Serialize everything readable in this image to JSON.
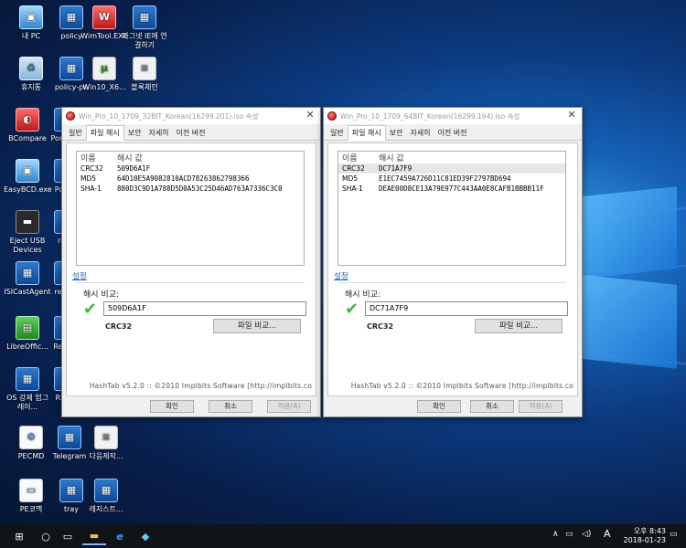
{
  "desktop": {
    "icons": [
      {
        "label": "내 PC",
        "glyph": "▣",
        "style": "g-pc"
      },
      {
        "label": "policy",
        "glyph": "▦",
        "style": "g-app"
      },
      {
        "label": "WimTool.EXE",
        "glyph": "W",
        "style": "g-red"
      },
      {
        "label": "마그넷 IE에 연결하기",
        "glyph": "▦",
        "style": "g-app"
      },
      {
        "label": "휴지통",
        "glyph": "♻",
        "style": "g-bin"
      },
      {
        "label": "policy-pe",
        "glyph": "▦",
        "style": "g-app"
      },
      {
        "label": "Win10_X6...",
        "glyph": "µ",
        "style": "g-tor"
      },
      {
        "label": "블록체인",
        "glyph": "≡",
        "style": "g-doc"
      },
      {
        "label": "BCompare",
        "glyph": "◐",
        "style": "g-red"
      },
      {
        "label": "Port 한글",
        "glyph": "▦",
        "style": "g-app"
      },
      {
        "label": "EasyBCD.exe",
        "glyph": "▣",
        "style": "g-pc"
      },
      {
        "label": "PotPla",
        "glyph": "▶",
        "style": "g-app"
      },
      {
        "label": "Eject USB Devices",
        "glyph": "▬",
        "style": "g-usb"
      },
      {
        "label": "rege",
        "glyph": "▦",
        "style": "g-app"
      },
      {
        "label": "ISICastAgent",
        "glyph": "▦",
        "style": "g-app"
      },
      {
        "label": "regedi",
        "glyph": "▦",
        "style": "g-app"
      },
      {
        "label": "LibreOffic...",
        "glyph": "▤",
        "style": "g-grn"
      },
      {
        "label": "RegWo",
        "glyph": "▦",
        "style": "g-app"
      },
      {
        "label": "OS 강제 업그레이...",
        "glyph": "▦",
        "style": "g-app"
      },
      {
        "label": "RS2업",
        "glyph": "▦",
        "style": "g-app"
      },
      {
        "label": "PECMD",
        "glyph": "⚙",
        "style": "g-tg"
      },
      {
        "label": "Telegram",
        "glyph": "▦",
        "style": "g-app"
      },
      {
        "label": "다음제작...",
        "glyph": "≡",
        "style": "g-doc"
      },
      {
        "label": "PE코맥",
        "glyph": "▭",
        "style": "g-tg"
      },
      {
        "label": "tray",
        "glyph": "▦",
        "style": "g-app"
      },
      {
        "label": "레지스트...",
        "glyph": "▦",
        "style": "g-app"
      }
    ]
  },
  "dialogs": [
    {
      "title": "Win_Pro_10_1709_32BIT_Korean(16299.201).iso 속성",
      "close": "✕",
      "tabs": [
        "일반",
        "파일 해시",
        "보안",
        "자세히",
        "이전 버전"
      ],
      "active_tab": 1,
      "list_header": {
        "name": "이름",
        "value": "해시 값"
      },
      "hashes": [
        {
          "name": "CRC32",
          "value": "509D6A1F"
        },
        {
          "name": "MD5",
          "value": "64D10E5A9082810ACD78263862798366"
        },
        {
          "name": "SHA-1",
          "value": "880D3C9D1A788D5D0A53C25D46AD763A7336C3C0"
        }
      ],
      "settings_link": "설정",
      "compare_label": "해시 비교:",
      "compare_value": "509D6A1F",
      "algorithm": "CRC32",
      "file_compare_button": "파일 비교...",
      "credit": "HashTab v5.2.0 :: ©2010 Implbits Software [http://implbits.co",
      "buttons": {
        "ok": "확인",
        "cancel": "취소",
        "apply": "적용(A)"
      }
    },
    {
      "title": "Win_Pro_10_1709_64BIT_Korean(16299.194).iso 속성",
      "close": "✕",
      "tabs": [
        "일반",
        "파일 해시",
        "보안",
        "자세히",
        "이전 버전"
      ],
      "active_tab": 1,
      "list_header": {
        "name": "이름",
        "value": "해시 값"
      },
      "hashes": [
        {
          "name": "CRC32",
          "value": "DC71A7F9"
        },
        {
          "name": "MD5",
          "value": "E1EC7459A726D11C81ED39F2797BD694"
        },
        {
          "name": "SHA-1",
          "value": "DEAE00D8CE13A79E977C443AA0E8CAFB1BBBB11F"
        }
      ],
      "settings_link": "설정",
      "compare_label": "해시 비교:",
      "compare_value": "DC71A7F9",
      "algorithm": "CRC32",
      "file_compare_button": "파일 비교...",
      "credit": "HashTab v5.2.0 :: ©2010 Implbits Software [http://implbits.co",
      "buttons": {
        "ok": "확인",
        "cancel": "취소",
        "apply": "적용(A)"
      }
    }
  ],
  "taskbar": {
    "start_icon": "⊞",
    "search_icon": "○",
    "taskview_icon": "▭",
    "explorer_icon": "▬",
    "ie_icon": "e",
    "app_icon": "◆",
    "tray_chevron": "∧",
    "network_icon": "▭",
    "volume_icon": "◁)",
    "ime": "A",
    "time": "오후 8:43",
    "date": "2018-01-23",
    "notification_icon": "▭"
  }
}
